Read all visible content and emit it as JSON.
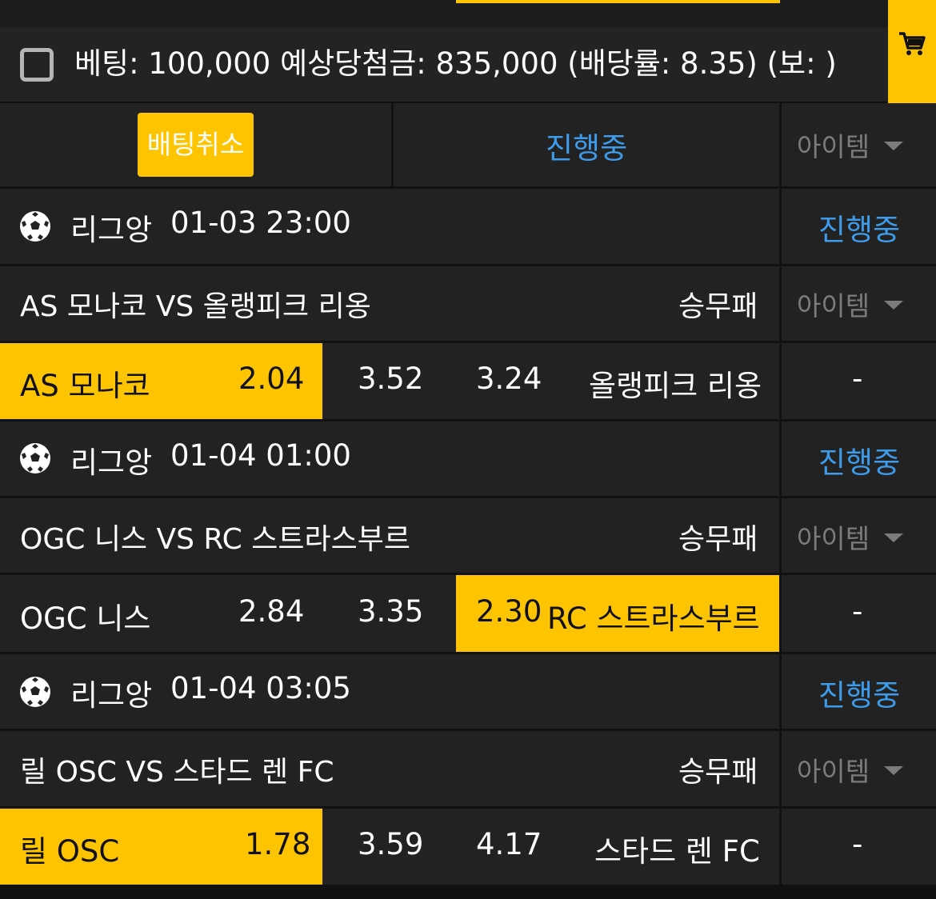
{
  "summary": {
    "text": "베팅: 100,000 예상당첨금: 835,000 (배당률: 8.35) (보: )"
  },
  "controls": {
    "cancel_label": "배팅취소",
    "status_label": "진행중",
    "item_label": "아이템"
  },
  "matches": [
    {
      "league": "리그앙",
      "datetime": "01-03 23:00",
      "status": "진행중",
      "title": "AS 모나코 VS 올랭피크 리옹",
      "market": "승무패",
      "item": "아이템",
      "home": "AS 모나코",
      "home_odds": "2.04",
      "draw_odds": "3.52",
      "away_odds": "3.24",
      "away": "올랭피크 리옹",
      "extra": "-"
    },
    {
      "league": "리그앙",
      "datetime": "01-04 01:00",
      "status": "진행중",
      "title": "OGC 니스 VS RC 스트라스부르",
      "market": "승무패",
      "item": "아이템",
      "home": "OGC 니스",
      "home_odds": "2.84",
      "draw_odds": "3.35",
      "away_odds": "2.30",
      "away": "RC 스트라스부르",
      "extra": "-"
    },
    {
      "league": "리그앙",
      "datetime": "01-04 03:05",
      "status": "진행중",
      "title": "릴 OSC VS 스타드 렌 FC",
      "market": "승무패",
      "item": "아이템",
      "home": "릴 OSC",
      "home_odds": "1.78",
      "draw_odds": "3.59",
      "away_odds": "4.17",
      "away": "스타드 렌 FC",
      "extra": "-"
    }
  ],
  "icons": {
    "cart": "shopping-cart-icon",
    "ball": "soccer-ball-icon",
    "caret": "caret-down-icon"
  },
  "colors": {
    "accent": "#ffc400",
    "status_blue": "#3d9be9",
    "cell_bg": "#222222"
  }
}
